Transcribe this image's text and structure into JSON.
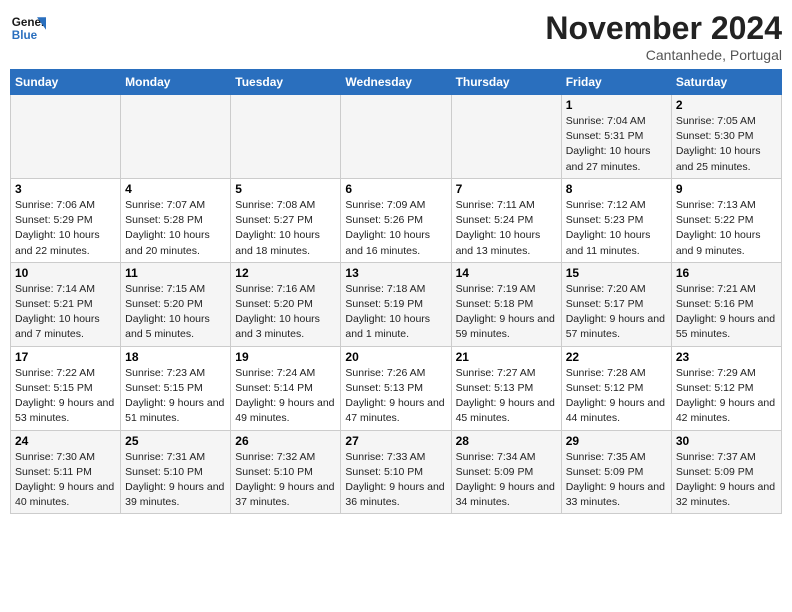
{
  "header": {
    "logo_general": "General",
    "logo_blue": "Blue",
    "title": "November 2024",
    "subtitle": "Cantanhede, Portugal"
  },
  "weekdays": [
    "Sunday",
    "Monday",
    "Tuesday",
    "Wednesday",
    "Thursday",
    "Friday",
    "Saturday"
  ],
  "weeks": [
    [
      {
        "day": "",
        "info": ""
      },
      {
        "day": "",
        "info": ""
      },
      {
        "day": "",
        "info": ""
      },
      {
        "day": "",
        "info": ""
      },
      {
        "day": "",
        "info": ""
      },
      {
        "day": "1",
        "info": "Sunrise: 7:04 AM\nSunset: 5:31 PM\nDaylight: 10 hours and 27 minutes."
      },
      {
        "day": "2",
        "info": "Sunrise: 7:05 AM\nSunset: 5:30 PM\nDaylight: 10 hours and 25 minutes."
      }
    ],
    [
      {
        "day": "3",
        "info": "Sunrise: 7:06 AM\nSunset: 5:29 PM\nDaylight: 10 hours and 22 minutes."
      },
      {
        "day": "4",
        "info": "Sunrise: 7:07 AM\nSunset: 5:28 PM\nDaylight: 10 hours and 20 minutes."
      },
      {
        "day": "5",
        "info": "Sunrise: 7:08 AM\nSunset: 5:27 PM\nDaylight: 10 hours and 18 minutes."
      },
      {
        "day": "6",
        "info": "Sunrise: 7:09 AM\nSunset: 5:26 PM\nDaylight: 10 hours and 16 minutes."
      },
      {
        "day": "7",
        "info": "Sunrise: 7:11 AM\nSunset: 5:24 PM\nDaylight: 10 hours and 13 minutes."
      },
      {
        "day": "8",
        "info": "Sunrise: 7:12 AM\nSunset: 5:23 PM\nDaylight: 10 hours and 11 minutes."
      },
      {
        "day": "9",
        "info": "Sunrise: 7:13 AM\nSunset: 5:22 PM\nDaylight: 10 hours and 9 minutes."
      }
    ],
    [
      {
        "day": "10",
        "info": "Sunrise: 7:14 AM\nSunset: 5:21 PM\nDaylight: 10 hours and 7 minutes."
      },
      {
        "day": "11",
        "info": "Sunrise: 7:15 AM\nSunset: 5:20 PM\nDaylight: 10 hours and 5 minutes."
      },
      {
        "day": "12",
        "info": "Sunrise: 7:16 AM\nSunset: 5:20 PM\nDaylight: 10 hours and 3 minutes."
      },
      {
        "day": "13",
        "info": "Sunrise: 7:18 AM\nSunset: 5:19 PM\nDaylight: 10 hours and 1 minute."
      },
      {
        "day": "14",
        "info": "Sunrise: 7:19 AM\nSunset: 5:18 PM\nDaylight: 9 hours and 59 minutes."
      },
      {
        "day": "15",
        "info": "Sunrise: 7:20 AM\nSunset: 5:17 PM\nDaylight: 9 hours and 57 minutes."
      },
      {
        "day": "16",
        "info": "Sunrise: 7:21 AM\nSunset: 5:16 PM\nDaylight: 9 hours and 55 minutes."
      }
    ],
    [
      {
        "day": "17",
        "info": "Sunrise: 7:22 AM\nSunset: 5:15 PM\nDaylight: 9 hours and 53 minutes."
      },
      {
        "day": "18",
        "info": "Sunrise: 7:23 AM\nSunset: 5:15 PM\nDaylight: 9 hours and 51 minutes."
      },
      {
        "day": "19",
        "info": "Sunrise: 7:24 AM\nSunset: 5:14 PM\nDaylight: 9 hours and 49 minutes."
      },
      {
        "day": "20",
        "info": "Sunrise: 7:26 AM\nSunset: 5:13 PM\nDaylight: 9 hours and 47 minutes."
      },
      {
        "day": "21",
        "info": "Sunrise: 7:27 AM\nSunset: 5:13 PM\nDaylight: 9 hours and 45 minutes."
      },
      {
        "day": "22",
        "info": "Sunrise: 7:28 AM\nSunset: 5:12 PM\nDaylight: 9 hours and 44 minutes."
      },
      {
        "day": "23",
        "info": "Sunrise: 7:29 AM\nSunset: 5:12 PM\nDaylight: 9 hours and 42 minutes."
      }
    ],
    [
      {
        "day": "24",
        "info": "Sunrise: 7:30 AM\nSunset: 5:11 PM\nDaylight: 9 hours and 40 minutes."
      },
      {
        "day": "25",
        "info": "Sunrise: 7:31 AM\nSunset: 5:10 PM\nDaylight: 9 hours and 39 minutes."
      },
      {
        "day": "26",
        "info": "Sunrise: 7:32 AM\nSunset: 5:10 PM\nDaylight: 9 hours and 37 minutes."
      },
      {
        "day": "27",
        "info": "Sunrise: 7:33 AM\nSunset: 5:10 PM\nDaylight: 9 hours and 36 minutes."
      },
      {
        "day": "28",
        "info": "Sunrise: 7:34 AM\nSunset: 5:09 PM\nDaylight: 9 hours and 34 minutes."
      },
      {
        "day": "29",
        "info": "Sunrise: 7:35 AM\nSunset: 5:09 PM\nDaylight: 9 hours and 33 minutes."
      },
      {
        "day": "30",
        "info": "Sunrise: 7:37 AM\nSunset: 5:09 PM\nDaylight: 9 hours and 32 minutes."
      }
    ]
  ]
}
